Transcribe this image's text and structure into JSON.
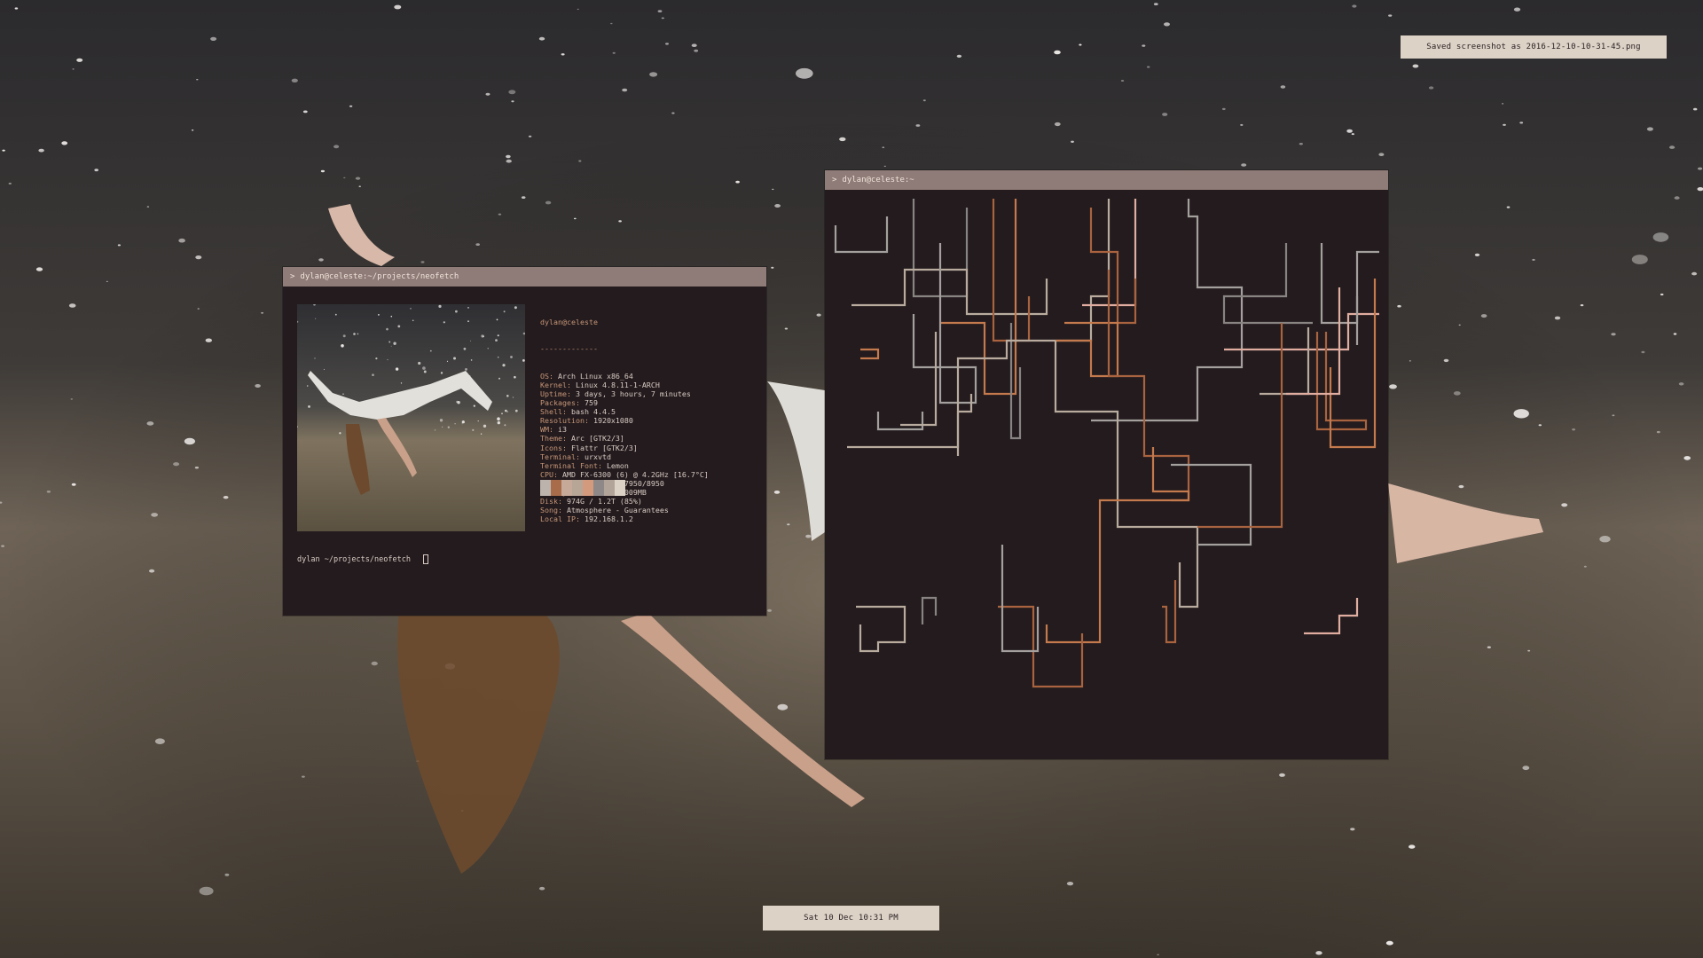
{
  "notification": {
    "text": "Saved screenshot as 2016-12-10-10-31-45.png"
  },
  "clock": {
    "text": "Sat 10 Dec 10:31 PM"
  },
  "term_neofetch": {
    "title": "dylan@celeste:~/projects/neofetch",
    "prompt_glyph": ">",
    "header": "dylan@celeste",
    "separator": "-------------",
    "info": [
      {
        "key": "OS",
        "value": "Arch Linux x86_64"
      },
      {
        "key": "Kernel",
        "value": "Linux 4.8.11-1-ARCH"
      },
      {
        "key": "Uptime",
        "value": "3 days, 3 hours, 7 minutes"
      },
      {
        "key": "Packages",
        "value": "759"
      },
      {
        "key": "Shell",
        "value": "bash 4.4.5"
      },
      {
        "key": "Resolution",
        "value": "1920x1080"
      },
      {
        "key": "WM",
        "value": "i3"
      },
      {
        "key": "Theme",
        "value": "Arc [GTK2/3]"
      },
      {
        "key": "Icons",
        "value": "Flattr [GTK2/3]"
      },
      {
        "key": "Terminal",
        "value": "urxvtd"
      },
      {
        "key": "Terminal Font",
        "value": "Lemon"
      },
      {
        "key": "CPU",
        "value": "AMD FX-6300 (6) @ 4.2GHz [16.7°C]"
      },
      {
        "key": "GPU",
        "value": "AMD Radeon HD 7950/8950"
      },
      {
        "key": "Memory",
        "value": "2623MB / 16009MB"
      },
      {
        "key": "Disk",
        "value": "974G / 1.2T (85%)"
      },
      {
        "key": "Song",
        "value": "Atmosphere - Guarantees"
      },
      {
        "key": "Local IP",
        "value": "192.168.1.2"
      }
    ],
    "palette": [
      "#bdb3ad",
      "#a96c4b",
      "#c7a99a",
      "#b7a596",
      "#d39a7e",
      "#8e8889",
      "#b3a49a",
      "#ddd2c6"
    ],
    "prompt": "dylan ~/projects/neofetch  "
  },
  "term_pipes": {
    "title": "dylan@celeste:~",
    "prompt_glyph": ">"
  },
  "colors": {
    "titlebar": "#8f7b77",
    "terminal_bg": "#231b1e",
    "notification_bg": "#ddd2c6",
    "pipe_colors": [
      "#a4a09e",
      "#b9ac9f",
      "#a9633f",
      "#c47a4d",
      "#e0ada0",
      "#888482"
    ]
  }
}
